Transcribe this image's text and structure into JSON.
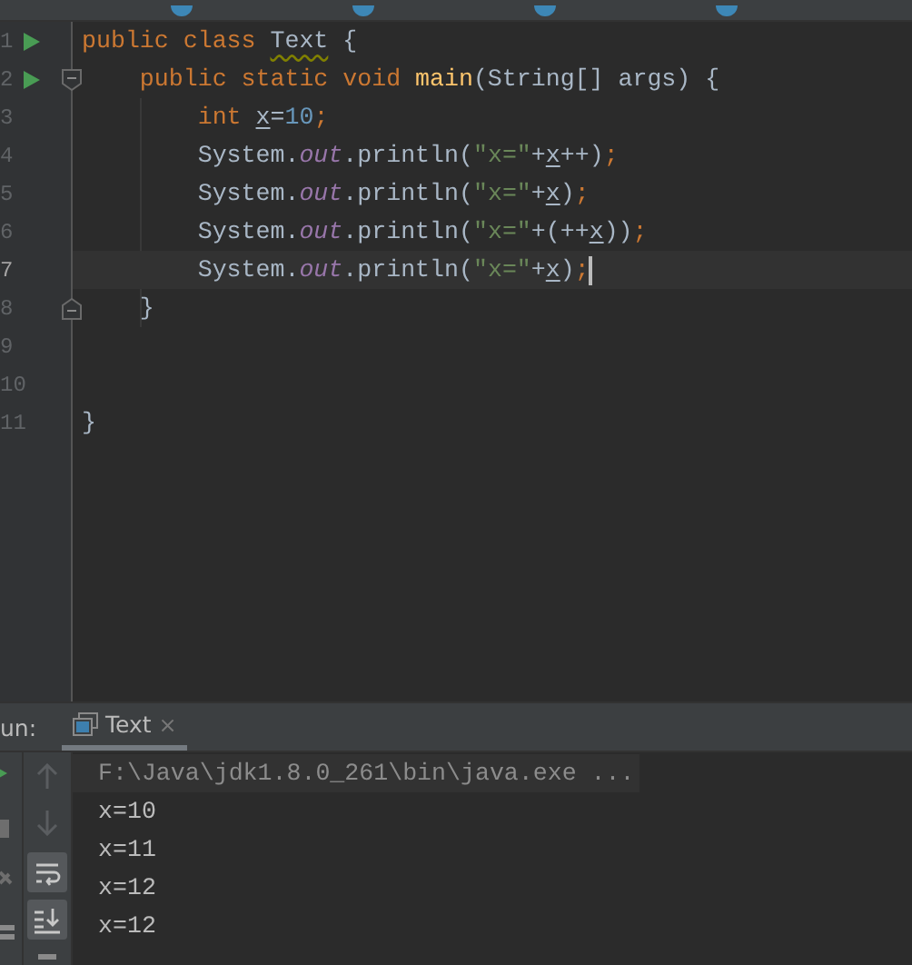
{
  "editor_tabs": [
    {
      "kind": "file"
    },
    {
      "kind": "file"
    },
    {
      "kind": "file"
    },
    {
      "kind": "file"
    }
  ],
  "code": {
    "lines": [
      {
        "number": "1",
        "run": true,
        "current": false,
        "tokens": [
          {
            "kind": "keyword",
            "text": "public class "
          },
          {
            "kind": "typo",
            "text": "Text"
          },
          {
            "kind": "plain",
            "text": " {"
          }
        ]
      },
      {
        "number": "2",
        "run": true,
        "fold_start": true,
        "current": false,
        "tokens": [
          {
            "kind": "keyword",
            "text": "    public static void "
          },
          {
            "kind": "method",
            "text": "main"
          },
          {
            "kind": "plain",
            "text": "(String[] args) {"
          }
        ]
      },
      {
        "number": "3",
        "run": false,
        "current": false,
        "tokens": [
          {
            "kind": "keyword",
            "text": "        int "
          },
          {
            "kind": "var",
            "text": "x"
          },
          {
            "kind": "plain",
            "text": "="
          },
          {
            "kind": "number",
            "text": "10"
          },
          {
            "kind": "keyword",
            "text": ";"
          }
        ]
      },
      {
        "number": "4",
        "run": false,
        "current": false,
        "tokens": [
          {
            "kind": "plain",
            "text": "        System."
          },
          {
            "kind": "field",
            "text": "out"
          },
          {
            "kind": "plain",
            "text": ".println("
          },
          {
            "kind": "string",
            "text": "\"x=\""
          },
          {
            "kind": "plain",
            "text": "+"
          },
          {
            "kind": "var",
            "text": "x"
          },
          {
            "kind": "plain",
            "text": "++)"
          },
          {
            "kind": "keyword",
            "text": ";"
          }
        ]
      },
      {
        "number": "5",
        "run": false,
        "current": false,
        "tokens": [
          {
            "kind": "plain",
            "text": "        System."
          },
          {
            "kind": "field",
            "text": "out"
          },
          {
            "kind": "plain",
            "text": ".println("
          },
          {
            "kind": "string",
            "text": "\"x=\""
          },
          {
            "kind": "plain",
            "text": "+"
          },
          {
            "kind": "var",
            "text": "x"
          },
          {
            "kind": "plain",
            "text": ")"
          },
          {
            "kind": "keyword",
            "text": ";"
          }
        ]
      },
      {
        "number": "6",
        "run": false,
        "current": false,
        "tokens": [
          {
            "kind": "plain",
            "text": "        System."
          },
          {
            "kind": "field",
            "text": "out"
          },
          {
            "kind": "plain",
            "text": ".println("
          },
          {
            "kind": "string",
            "text": "\"x=\""
          },
          {
            "kind": "plain",
            "text": "+(++"
          },
          {
            "kind": "var",
            "text": "x"
          },
          {
            "kind": "plain",
            "text": "))"
          },
          {
            "kind": "keyword",
            "text": ";"
          }
        ]
      },
      {
        "number": "7",
        "run": false,
        "current": true,
        "tokens": [
          {
            "kind": "plain",
            "text": "        System."
          },
          {
            "kind": "field",
            "text": "out"
          },
          {
            "kind": "plain",
            "text": ".println("
          },
          {
            "kind": "string",
            "text": "\"x=\""
          },
          {
            "kind": "plain",
            "text": "+"
          },
          {
            "kind": "var",
            "text": "x"
          },
          {
            "kind": "plain",
            "text": ")"
          },
          {
            "kind": "keyword",
            "text": ";"
          }
        ]
      },
      {
        "number": "8",
        "run": false,
        "fold_end": true,
        "current": false,
        "tokens": [
          {
            "kind": "plain",
            "text": "    }"
          }
        ]
      },
      {
        "number": "9",
        "run": false,
        "current": false
      },
      {
        "number": "10",
        "run": false,
        "current": false
      },
      {
        "number": "11",
        "run": false,
        "current": false,
        "tokens": [
          {
            "kind": "plain",
            "text": "}"
          }
        ]
      }
    ]
  },
  "run_panel": {
    "label": "un:",
    "tabs": [
      {
        "label": "Text",
        "selected": true,
        "close": "×"
      }
    ],
    "console": [
      {
        "kind": "command",
        "text": "F:\\Java\\jdk1.8.0_261\\bin\\java.exe ..."
      },
      {
        "kind": "output",
        "text": "x=10"
      },
      {
        "kind": "output",
        "text": "x=11"
      },
      {
        "kind": "output",
        "text": "x=12"
      },
      {
        "kind": "output",
        "text": "x=12"
      }
    ]
  }
}
